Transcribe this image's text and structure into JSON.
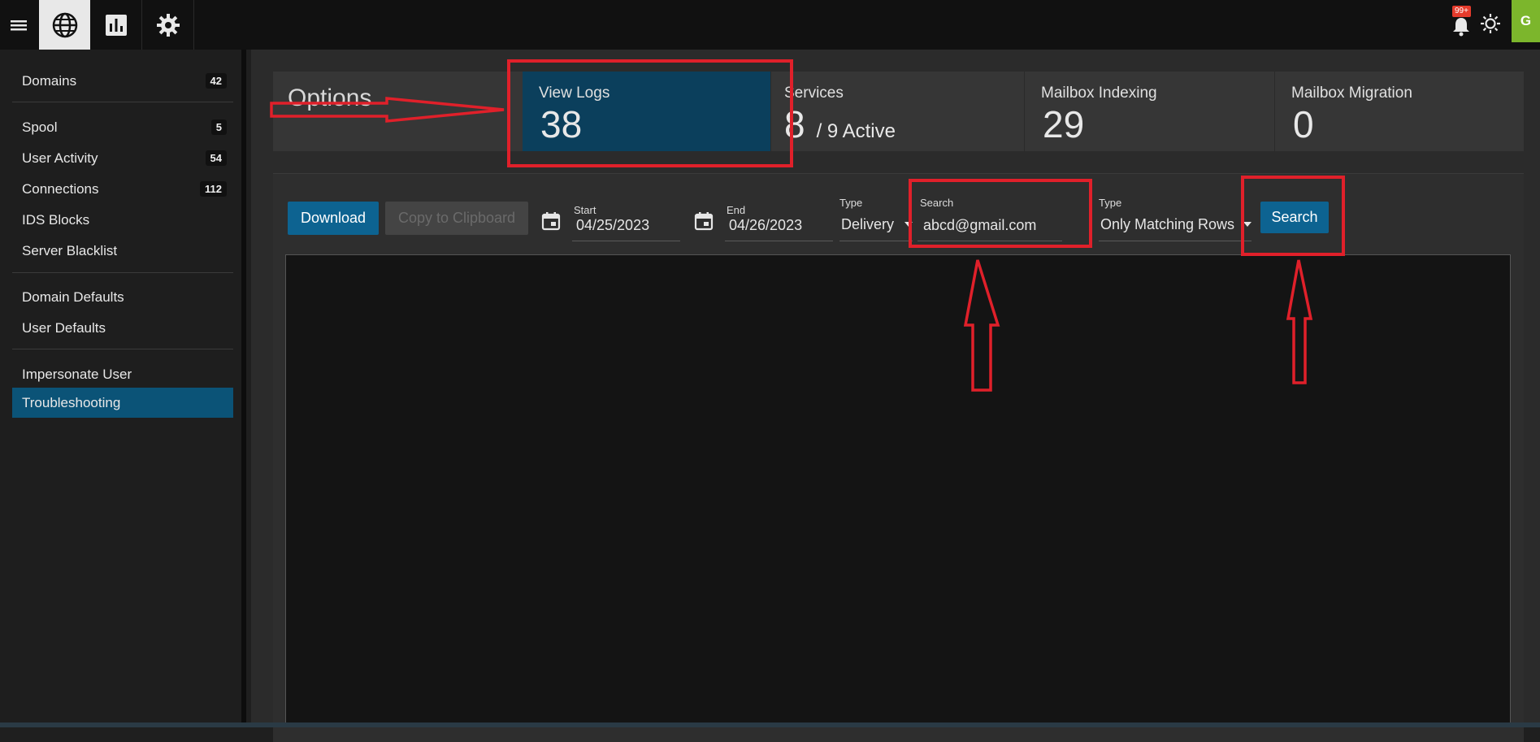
{
  "topbar": {
    "notification_badge": "99+",
    "avatar_initial": "G",
    "icons": [
      "menu-icon",
      "globe-icon",
      "chart-icon",
      "gear-icon",
      "bell-icon",
      "sun-icon"
    ]
  },
  "sidebar": {
    "items": [
      {
        "label": "Domains",
        "count": "42"
      },
      {
        "label": "Spool",
        "count": "5"
      },
      {
        "label": "User Activity",
        "count": "54"
      },
      {
        "label": "Connections",
        "count": "112"
      },
      {
        "label": "IDS Blocks",
        "count": ""
      },
      {
        "label": "Server Blacklist",
        "count": ""
      },
      {
        "label": "Domain Defaults",
        "count": ""
      },
      {
        "label": "User Defaults",
        "count": ""
      },
      {
        "label": "Impersonate User",
        "count": ""
      },
      {
        "label": "Troubleshooting",
        "count": ""
      }
    ],
    "active_item": "Troubleshooting"
  },
  "tiles": {
    "options_label": "Options",
    "view_logs": {
      "title": "View Logs",
      "value": "38"
    },
    "services": {
      "title": "Services",
      "value": "8",
      "sub": "/ 9 Active"
    },
    "mailbox_indexing": {
      "title": "Mailbox Indexing",
      "value": "29"
    },
    "mailbox_migration": {
      "title": "Mailbox Migration",
      "value": "0"
    }
  },
  "toolbar": {
    "download_label": "Download",
    "copy_label": "Copy to Clipboard",
    "start_label": "Start",
    "start_value": "04/25/2023",
    "end_label": "End",
    "end_value": "04/26/2023",
    "type_label": "Type",
    "type_value": "Delivery",
    "search_label": "Search",
    "search_value": "abcd@gmail.com",
    "type2_label": "Type",
    "type2_value": "Only Matching Rows",
    "search_button_label": "Search"
  },
  "colors": {
    "accent": "#0d6391",
    "active_tile": "#0b3f5c",
    "annotation": "#e0202a"
  }
}
